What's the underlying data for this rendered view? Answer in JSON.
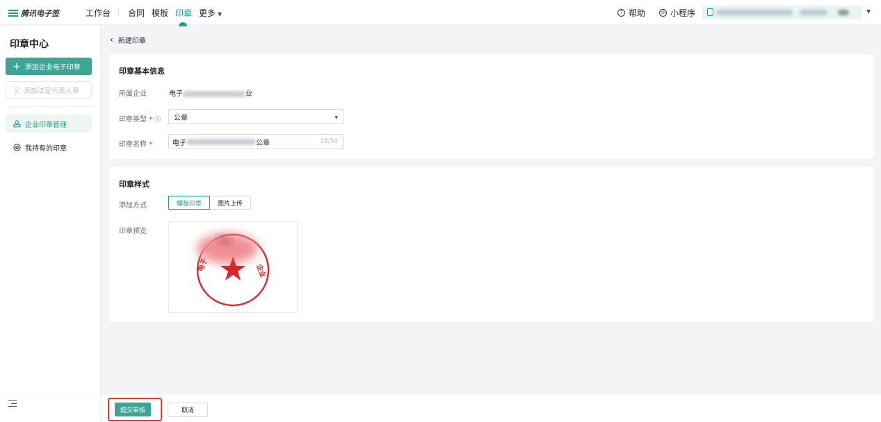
{
  "header": {
    "logo_text": "腾讯电子签",
    "nav": [
      {
        "label": "工作台"
      },
      {
        "label": "合同"
      },
      {
        "label": "模板"
      },
      {
        "label": "印章"
      },
      {
        "label": "更多"
      }
    ],
    "help_label": "帮助",
    "mini_program_label": "小程序"
  },
  "sidebar": {
    "title": "印章中心",
    "add_enterprise_seal": "添加企业电子印章",
    "add_legal_rep_seal": "添加法定代表人章",
    "items": [
      {
        "label": "企业印章管理",
        "active": true
      },
      {
        "label": "我持有的印章",
        "active": false
      }
    ]
  },
  "breadcrumb": {
    "label": "新建印章"
  },
  "basic_info": {
    "title": "印章基本信息",
    "enterprise_label": "所属企业",
    "enterprise_value_prefix": "电子",
    "enterprise_value_suffix": "业",
    "seal_type_label": "印章类型",
    "seal_type_required": "*",
    "seal_type_value": "公章",
    "seal_name_label": "印章名称",
    "seal_name_required": "*",
    "seal_name_prefix": "电子",
    "seal_name_suffix": "公章",
    "seal_name_count": "15/50"
  },
  "style": {
    "title": "印章样式",
    "method_label": "添加方式",
    "methods": [
      {
        "label": "模板印章",
        "active": true
      },
      {
        "label": "图片上传",
        "active": false
      }
    ],
    "preview_label": "印章预览",
    "seal_text_left": "电子",
    "seal_text_right": "企业"
  },
  "footer": {
    "submit_label": "提交审核",
    "cancel_label": "取消"
  },
  "colors": {
    "accent": "#19a28a",
    "button_primary": "#3da595",
    "highlight": "#e53935",
    "seal_red": "#e0242b"
  }
}
